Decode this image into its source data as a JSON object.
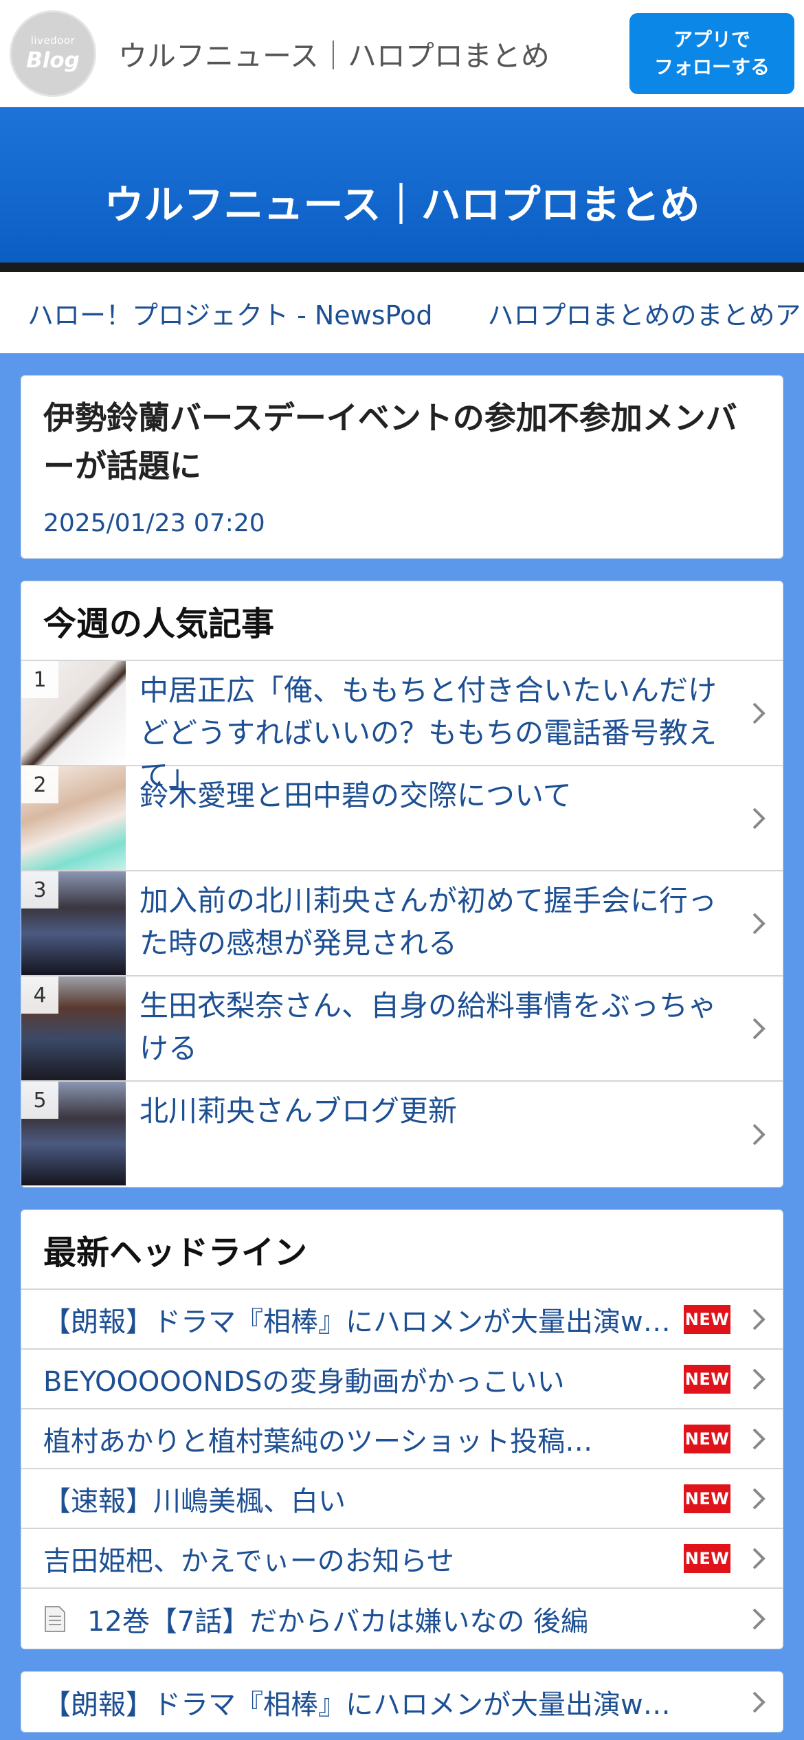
{
  "topbar": {
    "logo_small": "livedoor",
    "logo_big": "Blog",
    "site_name": "ウルフニュース｜ハロプロまとめ",
    "follow_line1": "アプリで",
    "follow_line2": "フォローする"
  },
  "hero": {
    "title": "ウルフニュース｜ハロプロまとめ"
  },
  "strip": {
    "links": [
      "ハロー！プロジェクト - NewsPod",
      "ハロプロまとめのまとめア"
    ]
  },
  "article": {
    "title": "伊勢鈴蘭バースデーイベントの参加不参加メンバーが話題に",
    "date": "2025/01/23 07:20"
  },
  "popular": {
    "heading": "今週の人気記事",
    "items": [
      {
        "rank": "1",
        "title": "中居正広「俺、ももちと付き合いたいんだけどどうすればいいの？ももちの電話番号教えて」"
      },
      {
        "rank": "2",
        "title": "鈴木愛理と田中碧の交際について"
      },
      {
        "rank": "3",
        "title": "加入前の北川莉央さんが初めて握手会に行った時の感想が発見される"
      },
      {
        "rank": "4",
        "title": "生田衣梨奈さん、自身の給料事情をぶっちゃける"
      },
      {
        "rank": "5",
        "title": "北川莉央さんブログ更新"
      }
    ]
  },
  "headlines": {
    "heading": "最新ヘッドライン",
    "new_label": "NEW",
    "items": [
      {
        "title": "【朗報】ドラマ『相棒』にハロメンが大量出演w…"
      },
      {
        "title": "BEYOOOOONDSの変身動画がかっこいい"
      },
      {
        "title": "植村あかりと植村葉純のツーショット投稿…"
      },
      {
        "title": "【速報】川嶋美楓、白い"
      },
      {
        "title": "吉田姫杷、かえでぃーのお知らせ"
      },
      {
        "title": "12巻【7話】だからバカは嫌いなの 後編"
      }
    ]
  },
  "bottom": {
    "title": "【朗報】ドラマ『相棒』にハロメンが大量出演w…"
  }
}
